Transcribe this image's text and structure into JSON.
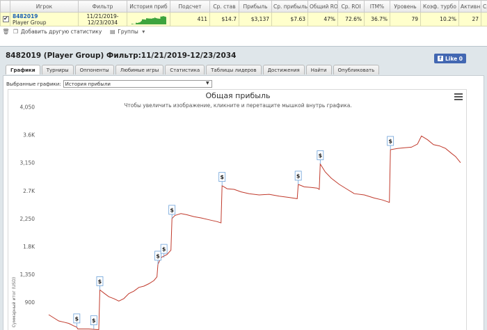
{
  "stats": {
    "headers": [
      "Игрок",
      "Фильтр",
      "История приб",
      "Подсчет",
      "Ср. став",
      "Прибыль",
      "Ср. прибыль",
      "Общий ROI",
      "Ср. ROI",
      "ITM%",
      "Уровень",
      "Коэф. турбо",
      "Активн",
      "Ср"
    ],
    "row": {
      "player_id": "8482019",
      "player_group": "Player Group",
      "filter_line1": "11/21/2019-",
      "filter_line2": "12/23/2034",
      "count": "411",
      "avg_stake": "$14.7",
      "profit": "$3,137",
      "avg_profit": "$7.63",
      "total_roi": "47%",
      "avg_roi": "72.6%",
      "itm": "36.7%",
      "level": "79",
      "turbo_ratio": "10.2%",
      "active": "27"
    },
    "sparkline_color": "#3ea43e"
  },
  "toolbar": {
    "add_stats_label": "Добавить другую статистику",
    "groups_label": "Группы"
  },
  "panel": {
    "title": "8482019 (Player Group) Фильтр:11/21/2019-12/23/2034",
    "fb_like": "Like 0",
    "tabs": [
      "Графики",
      "Турниры",
      "Оппоненты",
      "Любимые игры",
      "Статистика",
      "Таблицы лидеров",
      "Достижения",
      "Найти",
      "Опубликовать"
    ],
    "active_tab": 0,
    "selector_label": "Выбранные графики:",
    "selector_value": "История прибыли"
  },
  "chart_data": {
    "type": "line",
    "title": "Общая прибыль",
    "subtitle": "Чтобы увеличить изображение, кликните и перетащите мышкой внутрь графика.",
    "ylabel": "Суммарный итог (USD)",
    "xlabel": "",
    "y_ticks": [
      900,
      1350,
      1800,
      2250,
      2700,
      3150,
      3600,
      4050
    ],
    "y_tick_labels": [
      "900",
      "1,350",
      "1.8K",
      "2,250",
      "2.7K",
      "3,150",
      "3.6K",
      "4,050"
    ],
    "ylim": [
      420,
      4100
    ],
    "xlim": [
      0,
      411
    ],
    "grid": false,
    "line_color": "#c0392b",
    "marker_symbol": "$",
    "series": [
      {
        "values": [
          [
            0,
            700
          ],
          [
            5,
            650
          ],
          [
            10,
            600
          ],
          [
            15,
            580
          ],
          [
            20,
            560
          ],
          [
            25,
            520
          ],
          [
            28,
            500
          ],
          [
            29,
            470
          ],
          [
            30,
            470
          ],
          [
            40,
            470
          ],
          [
            48,
            460
          ],
          [
            50,
            460
          ],
          [
            51,
            1100
          ],
          [
            55,
            1050
          ],
          [
            60,
            990
          ],
          [
            65,
            960
          ],
          [
            70,
            920
          ],
          [
            75,
            960
          ],
          [
            80,
            1040
          ],
          [
            85,
            1080
          ],
          [
            90,
            1140
          ],
          [
            95,
            1160
          ],
          [
            100,
            1200
          ],
          [
            105,
            1250
          ],
          [
            108,
            1310
          ],
          [
            109,
            1510
          ],
          [
            112,
            1620
          ],
          [
            118,
            1670
          ],
          [
            122,
            1740
          ],
          [
            123,
            2250
          ],
          [
            126,
            2300
          ],
          [
            132,
            2330
          ],
          [
            138,
            2310
          ],
          [
            145,
            2280
          ],
          [
            152,
            2260
          ],
          [
            160,
            2230
          ],
          [
            168,
            2200
          ],
          [
            172,
            2180
          ],
          [
            173,
            2780
          ],
          [
            178,
            2730
          ],
          [
            185,
            2720
          ],
          [
            192,
            2680
          ],
          [
            200,
            2650
          ],
          [
            210,
            2630
          ],
          [
            220,
            2640
          ],
          [
            230,
            2610
          ],
          [
            240,
            2590
          ],
          [
            248,
            2570
          ],
          [
            249,
            2800
          ],
          [
            255,
            2760
          ],
          [
            262,
            2750
          ],
          [
            268,
            2740
          ],
          [
            270,
            2720
          ],
          [
            271,
            3130
          ],
          [
            276,
            3000
          ],
          [
            282,
            2900
          ],
          [
            290,
            2800
          ],
          [
            298,
            2720
          ],
          [
            305,
            2650
          ],
          [
            315,
            2630
          ],
          [
            325,
            2580
          ],
          [
            333,
            2550
          ],
          [
            340,
            2510
          ],
          [
            341,
            3360
          ],
          [
            348,
            3380
          ],
          [
            355,
            3390
          ],
          [
            362,
            3400
          ],
          [
            368,
            3450
          ],
          [
            372,
            3580
          ],
          [
            378,
            3520
          ],
          [
            384,
            3440
          ],
          [
            390,
            3420
          ],
          [
            396,
            3380
          ],
          [
            402,
            3300
          ],
          [
            406,
            3250
          ],
          [
            411,
            3150
          ]
        ]
      }
    ],
    "markers": [
      [
        28,
        500
      ],
      [
        45,
        470
      ],
      [
        51,
        1100
      ],
      [
        109,
        1510
      ],
      [
        115,
        1620
      ],
      [
        123,
        2250
      ],
      [
        173,
        2780
      ],
      [
        249,
        2800
      ],
      [
        271,
        3130
      ],
      [
        341,
        3360
      ]
    ]
  }
}
